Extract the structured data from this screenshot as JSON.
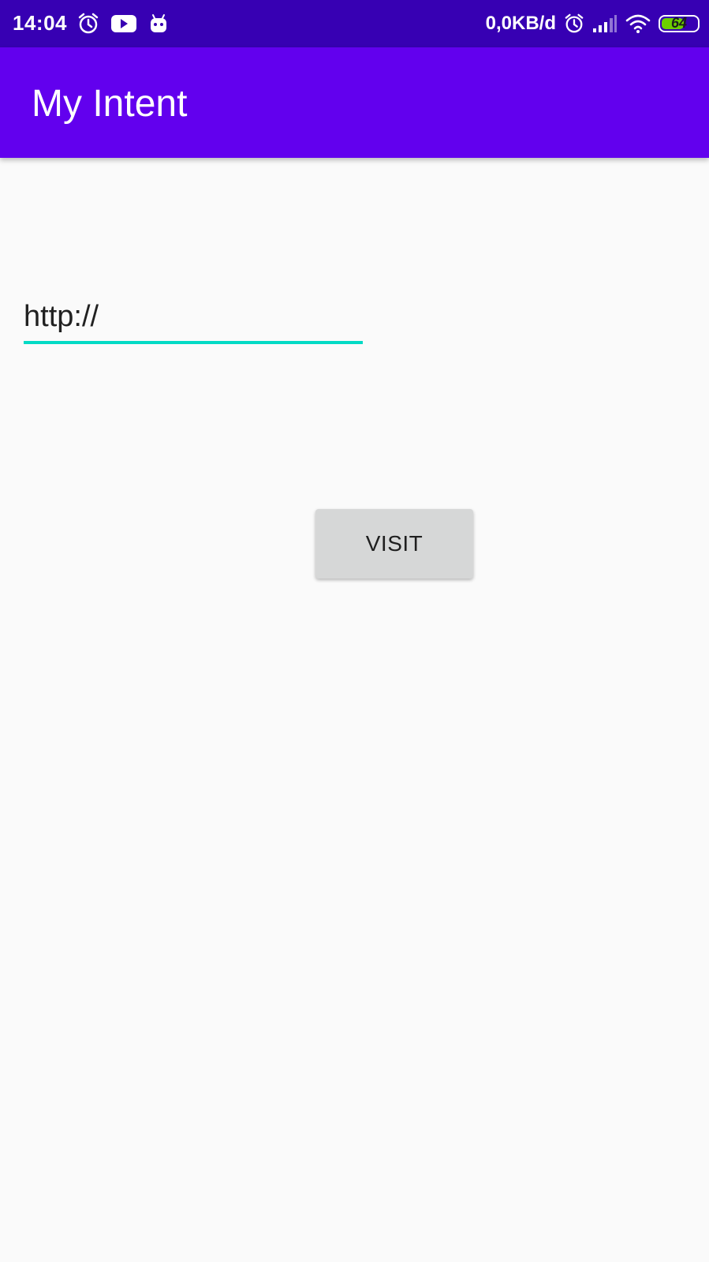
{
  "status_bar": {
    "time": "14:04",
    "network_speed": "0,0KB/d",
    "battery_level": "64",
    "battery_fraction": 0.64,
    "left_icons": [
      "alarm-icon",
      "youtube-icon",
      "android-icon"
    ],
    "right_icons": [
      "alarm-icon",
      "signal-icon",
      "wifi-icon",
      "battery-icon"
    ],
    "background_color": "#3700b3"
  },
  "app_bar": {
    "title": "My Intent",
    "background_color": "#6200ee"
  },
  "form": {
    "url_value": "http://",
    "underline_color": "#03dac5",
    "visit_button_label": "VISIT"
  }
}
